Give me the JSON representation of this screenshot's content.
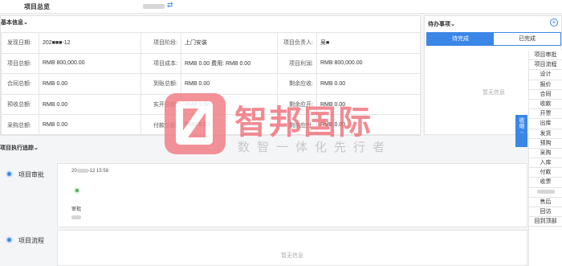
{
  "topbar": {
    "title": "项目总览",
    "swap_icon": "⇄"
  },
  "basic": {
    "header": "基本信息",
    "rows": [
      {
        "k1": "发现日期:",
        "v1": "202■■■-12",
        "k2": "项目阶段:",
        "v2": "上门安装",
        "k3": "项目负责人:",
        "v3": "吴■"
      },
      {
        "k1": "项目总额:",
        "v1": "RMB 800,000.00",
        "k2": "项目成本:",
        "v2": "RMB 0.00   费用: RMB 0.00",
        "k3": "项目利润:",
        "v3": "RMB 800,000.00"
      },
      {
        "k1": "合同总额:",
        "v1": "RMB 0.00",
        "k2": "到账总额:",
        "v2": "RMB 0.00",
        "k3": "剩余应收:",
        "v3": "RMB 0.00"
      },
      {
        "k1": "预收总额:",
        "v1": "RMB 0.00",
        "k2": "实开总额:",
        "v2": "RMB 0.00",
        "k3": "剩余应开:",
        "v3": "RMB 0.00"
      },
      {
        "k1": "采购总额:",
        "v1": "RMB 0.00",
        "k2": "付款总额:",
        "v2": "RMB 0.00",
        "k3": "剩余应付:",
        "v3": "RMB 0.00"
      }
    ]
  },
  "todo": {
    "header": "待办事项",
    "tab_pending": "待完成",
    "tab_done": "已完成",
    "empty": "暂无信息"
  },
  "watermark": {
    "brand": "智邦国际",
    "slogan": "数智一体化先行者"
  },
  "recv_button": "收缩",
  "recv_arrow": "→",
  "track": {
    "header": "项目执行追踪",
    "step1": {
      "label": "项目审批",
      "time": "-12 15:58",
      "time_prefix": "20",
      "node_label": "审批"
    },
    "step2": {
      "label": "项目流程",
      "empty": "暂无信息"
    }
  },
  "menu": [
    "项目审批",
    "项目流程",
    "设计",
    "报价",
    "合同",
    "收款",
    "开票",
    "出库",
    "发货",
    "预购",
    "采购",
    "入库",
    "付款",
    "收票",
    "",
    "售后",
    "回访",
    "回到顶部"
  ]
}
